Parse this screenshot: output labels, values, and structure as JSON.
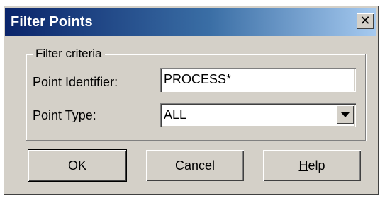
{
  "window": {
    "title": "Filter Points",
    "close_glyph": "✕"
  },
  "filter_group": {
    "legend": "Filter criteria",
    "point_identifier_label": "Point Identifier:",
    "point_identifier_value": "PROCESS*",
    "point_type_label": "Point Type:",
    "point_type_value": "ALL"
  },
  "buttons": {
    "ok": "OK",
    "cancel": "Cancel",
    "help_mnemonic": "H",
    "help_rest": "elp"
  }
}
